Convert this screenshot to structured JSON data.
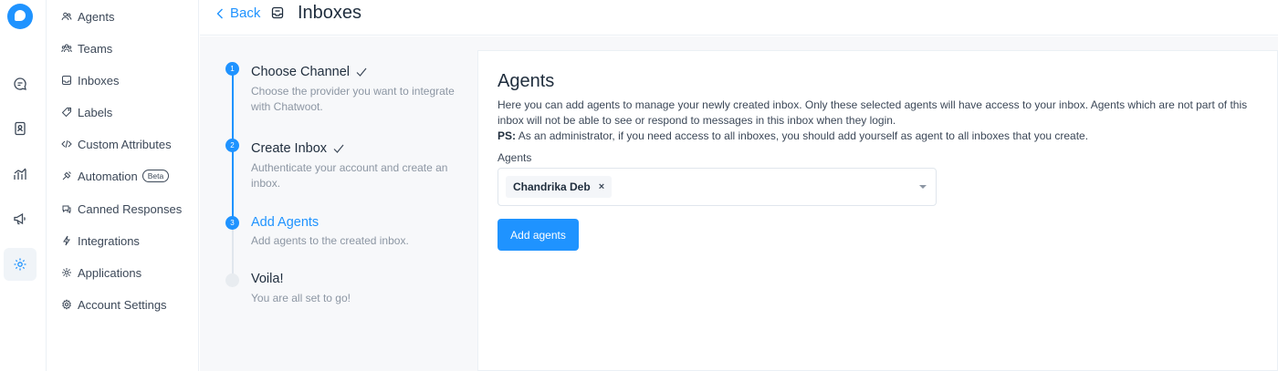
{
  "header": {
    "back_label": "Back",
    "title": "Inboxes"
  },
  "rail": {
    "icons": [
      "logo",
      "conversations-icon",
      "contacts-icon",
      "reports-icon",
      "campaigns-icon",
      "settings-icon"
    ],
    "active": "settings-icon"
  },
  "sidebar": {
    "items": [
      {
        "label": "Agents",
        "icon": "agents-icon"
      },
      {
        "label": "Teams",
        "icon": "teams-icon"
      },
      {
        "label": "Inboxes",
        "icon": "inbox-icon"
      },
      {
        "label": "Labels",
        "icon": "tag-icon"
      },
      {
        "label": "Custom Attributes",
        "icon": "code-icon"
      },
      {
        "label": "Automation",
        "icon": "automation-icon",
        "badge": "Beta"
      },
      {
        "label": "Canned Responses",
        "icon": "chat-icon"
      },
      {
        "label": "Integrations",
        "icon": "flash-icon"
      },
      {
        "label": "Applications",
        "icon": "apps-icon"
      },
      {
        "label": "Account Settings",
        "icon": "gear-icon"
      }
    ]
  },
  "wizard": {
    "steps": [
      {
        "num": "1",
        "title": "Choose Channel",
        "desc": "Choose the provider you want to integrate with Chatwoot.",
        "state": "done"
      },
      {
        "num": "2",
        "title": "Create Inbox",
        "desc": "Authenticate your account and create an inbox.",
        "state": "done"
      },
      {
        "num": "3",
        "title": "Add Agents",
        "desc": "Add agents to the created inbox.",
        "state": "active"
      },
      {
        "num": "4",
        "title": "Voila!",
        "desc": "You are all set to go!",
        "state": "pending"
      }
    ]
  },
  "content": {
    "title": "Agents",
    "description": "Here you can add agents to manage your newly created inbox. Only these selected agents will have access to your inbox. Agents which are not part of this inbox will not be able to see or respond to messages in this inbox when they login.",
    "ps_label": "PS:",
    "ps_text": " As an administrator, if you need access to all inboxes, you should add yourself as agent to all inboxes that you create.",
    "field_label": "Agents",
    "selected_agents": [
      "Chandrika Deb"
    ],
    "remove_symbol": "×",
    "submit_label": "Add agents"
  },
  "colors": {
    "accent": "#1f93ff",
    "text": "#1f2d3d",
    "muted": "#8c96a3",
    "background": "#f7f8fa"
  }
}
